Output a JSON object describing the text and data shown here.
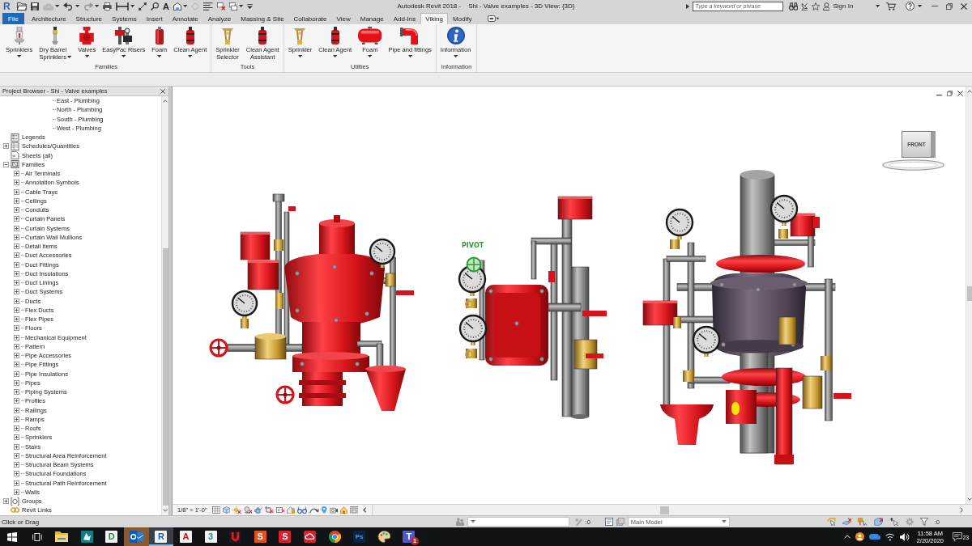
{
  "title_bar": {
    "logo": "R",
    "quick_access": [
      {
        "kind": "open",
        "dropdown": false,
        "disabled": false
      },
      {
        "kind": "save",
        "dropdown": false,
        "disabled": false
      },
      {
        "kind": "sync",
        "dropdown": true,
        "disabled": true
      },
      {
        "kind": "undo",
        "dropdown": true,
        "disabled": false
      },
      {
        "kind": "redo",
        "dropdown": true,
        "disabled": true
      },
      {
        "kind": "print",
        "dropdown": false,
        "disabled": false
      },
      {
        "kind": "measure",
        "dropdown": true,
        "disabled": false
      },
      {
        "kind": "dimension",
        "dropdown": false,
        "disabled": false
      },
      {
        "kind": "tag",
        "dropdown": false,
        "disabled": false
      },
      {
        "kind": "text",
        "glyph": "A",
        "dropdown": false,
        "disabled": false
      },
      {
        "kind": "house",
        "dropdown": true,
        "disabled": false
      },
      {
        "kind": "section",
        "dropdown": false,
        "disabled": true
      },
      {
        "kind": "thinlines",
        "dropdown": false,
        "disabled": false
      },
      {
        "kind": "closehidden",
        "dropdown": false,
        "disabled": false
      },
      {
        "kind": "windows",
        "dropdown": true,
        "disabled": false
      },
      {
        "kind": "customize",
        "dropdown": false,
        "disabled": false
      }
    ],
    "title": "Autodesk Revit 2018 -",
    "document": "Shi - Valve examples - 3D View: {3D}",
    "search": {
      "placeholder": "Type a keyword or phrase"
    },
    "sign_in": "Sign In"
  },
  "tabs": [
    {
      "label": "File",
      "kind": "menu",
      "selected": false
    },
    {
      "label": "Architecture",
      "kind": "tab",
      "selected": false
    },
    {
      "label": "Structure",
      "kind": "tab",
      "selected": false
    },
    {
      "label": "Systems",
      "kind": "tab",
      "selected": false
    },
    {
      "label": "Insert",
      "kind": "tab",
      "selected": false
    },
    {
      "label": "Annotate",
      "kind": "tab",
      "selected": false
    },
    {
      "label": "Analyze",
      "kind": "tab",
      "selected": false
    },
    {
      "label": "Massing & Site",
      "kind": "tab",
      "selected": false
    },
    {
      "label": "Collaborate",
      "kind": "tab",
      "selected": false
    },
    {
      "label": "View",
      "kind": "tab",
      "selected": false
    },
    {
      "label": "Manage",
      "kind": "tab",
      "selected": false
    },
    {
      "label": "Add-Ins",
      "kind": "tab",
      "selected": false
    },
    {
      "label": "Viking",
      "kind": "tab",
      "selected": true
    },
    {
      "label": "Modify",
      "kind": "tab",
      "selected": false
    }
  ],
  "ribbon": {
    "panels": [
      {
        "title": "Families",
        "buttons": [
          {
            "label": "Sprinklers",
            "kind": "pendant",
            "dropdown": true
          },
          {
            "label": "Dry Barrel\nSprinklers",
            "kind": "barrel",
            "dropdown": true
          },
          {
            "label": "Valves",
            "kind": "valve",
            "dropdown": true
          },
          {
            "label": "EasyPac Risers",
            "kind": "riser",
            "dropdown": true
          },
          {
            "label": "Foam",
            "kind": "foam",
            "dropdown": true
          },
          {
            "label": "Clean Agent",
            "kind": "agent",
            "dropdown": true
          }
        ]
      },
      {
        "title": "Tools",
        "buttons": [
          {
            "label": "Sprinkler\nSelector",
            "kind": "upright",
            "dropdown": false
          },
          {
            "label": "Clean Agent\nAssistant",
            "kind": "agent",
            "dropdown": false
          }
        ]
      },
      {
        "title": "Utilties",
        "buttons": [
          {
            "label": "Sprinkler",
            "kind": "upright",
            "dropdown": true
          },
          {
            "label": "Clean Agent",
            "kind": "agent",
            "dropdown": true
          },
          {
            "label": "Foam",
            "kind": "tank",
            "dropdown": true
          },
          {
            "label": "Pipe and fittings",
            "kind": "elbow",
            "dropdown": true
          }
        ]
      },
      {
        "title": "Information",
        "buttons": [
          {
            "label": "Information",
            "kind": "info",
            "dropdown": true
          }
        ]
      }
    ]
  },
  "project_browser": {
    "title": "Project Browser - Shi - Valve examples",
    "tree": [
      {
        "children": [
          {
            "children": [
              {
                "children": [
                  {
                    "children": [
                      {
                        "label": "East - Plumbing"
                      },
                      {
                        "label": "North - Plumbing"
                      },
                      {
                        "label": "South - Plumbing"
                      },
                      {
                        "label": "West - Plumbing"
                      }
                    ]
                  }
                ]
              }
            ]
          }
        ]
      },
      {
        "label": "Legends",
        "kind": "legend"
      },
      {
        "label": "Schedules/Quantities",
        "kind": "schedule",
        "expanded": false
      },
      {
        "label": "Sheets (all)",
        "kind": "sheet"
      },
      {
        "label": "Families",
        "kind": "family",
        "expanded": true,
        "children": [
          {
            "label": "Air Terminals",
            "expanded": false
          },
          {
            "label": "Annotation Symbols",
            "expanded": false
          },
          {
            "label": "Cable Trays",
            "expanded": false
          },
          {
            "label": "Ceilings",
            "expanded": false
          },
          {
            "label": "Conduits",
            "expanded": false
          },
          {
            "label": "Curtain Panels",
            "expanded": false
          },
          {
            "label": "Curtain Systems",
            "expanded": false
          },
          {
            "label": "Curtain Wall Mullions",
            "expanded": false
          },
          {
            "label": "Detail Items",
            "expanded": false
          },
          {
            "label": "Duct Accessories",
            "expanded": false
          },
          {
            "label": "Duct Fittings",
            "expanded": false
          },
          {
            "label": "Duct Insulations",
            "expanded": false
          },
          {
            "label": "Duct Linings",
            "expanded": false
          },
          {
            "label": "Duct Systems",
            "expanded": false
          },
          {
            "label": "Ducts",
            "expanded": false
          },
          {
            "label": "Flex Ducts",
            "expanded": false
          },
          {
            "label": "Flex Pipes",
            "expanded": false
          },
          {
            "label": "Floors",
            "expanded": false
          },
          {
            "label": "Mechanical Equipment",
            "expanded": false
          },
          {
            "label": "Pattern",
            "expanded": false
          },
          {
            "label": "Pipe Accessories",
            "expanded": false
          },
          {
            "label": "Pipe Fittings",
            "expanded": false
          },
          {
            "label": "Pipe Insulations",
            "expanded": false
          },
          {
            "label": "Pipes",
            "expanded": false
          },
          {
            "label": "Piping Systems",
            "expanded": false
          },
          {
            "label": "Profiles",
            "expanded": false
          },
          {
            "label": "Railings",
            "expanded": false
          },
          {
            "label": "Ramps",
            "expanded": false
          },
          {
            "label": "Roofs",
            "expanded": false
          },
          {
            "label": "Sprinklers",
            "expanded": false
          },
          {
            "label": "Stairs",
            "expanded": false
          },
          {
            "label": "Structural Area Reinforcement",
            "expanded": false
          },
          {
            "label": "Structural Beam Systems",
            "expanded": false
          },
          {
            "label": "Structural Foundations",
            "expanded": false
          },
          {
            "label": "Structural Path Reinforcement",
            "expanded": false
          },
          {
            "label": "Walls",
            "expanded": false
          }
        ]
      },
      {
        "label": "Groups",
        "kind": "group",
        "expanded": false
      },
      {
        "label": "Revit Links",
        "kind": "link"
      }
    ]
  },
  "view": {
    "pivot": "PIVOT",
    "view_cube": "FRONT",
    "scale": "1/8\" = 1'-0\""
  },
  "status_bar": {
    "prompt": "Click or Drag",
    "editable_count": ":0",
    "design_option": "Main Model",
    "filter_count": ":0"
  },
  "taskbar": {
    "apps": [
      {
        "kind": "folder",
        "selected": false,
        "flashing": false
      },
      {
        "kind": "arrow",
        "selected": false,
        "flashing": false
      },
      {
        "kind": "letter",
        "glyph": "D",
        "color": "#1e8c4e",
        "selected": false,
        "flashing": false
      },
      {
        "kind": "mail",
        "selected": false,
        "flashing": true
      },
      {
        "kind": "letter",
        "glyph": "R",
        "color": "#1d5ea8",
        "selected": true,
        "flashing": false
      },
      {
        "kind": "letter",
        "glyph": "A",
        "color": "#c4161c",
        "selected": false,
        "flashing": false
      },
      {
        "kind": "letter",
        "glyph": "3",
        "color": "#14928c",
        "selected": false,
        "flashing": false
      },
      {
        "kind": "horseshoe",
        "selected": false,
        "flashing": false
      },
      {
        "kind": "block",
        "glyph": "S",
        "color": "#e3501f",
        "selected": false,
        "flashing": false
      },
      {
        "kind": "block",
        "glyph": "S",
        "color": "#d81f2d",
        "selected": false,
        "flashing": false
      },
      {
        "kind": "cloud",
        "selected": false,
        "flashing": false
      },
      {
        "kind": "ball",
        "selected": false,
        "flashing": false
      },
      {
        "kind": "dark",
        "glyph": "Ps",
        "color": "#0b2240",
        "selected": false,
        "flashing": false
      },
      {
        "kind": "palette",
        "selected": false,
        "flashing": false
      },
      {
        "kind": "block",
        "glyph": "T",
        "color": "#5059c9",
        "badge": "1",
        "selected": false,
        "flashing": false
      }
    ],
    "time": "11:58 AM",
    "date": "2/20/2020",
    "notifications": "23"
  }
}
